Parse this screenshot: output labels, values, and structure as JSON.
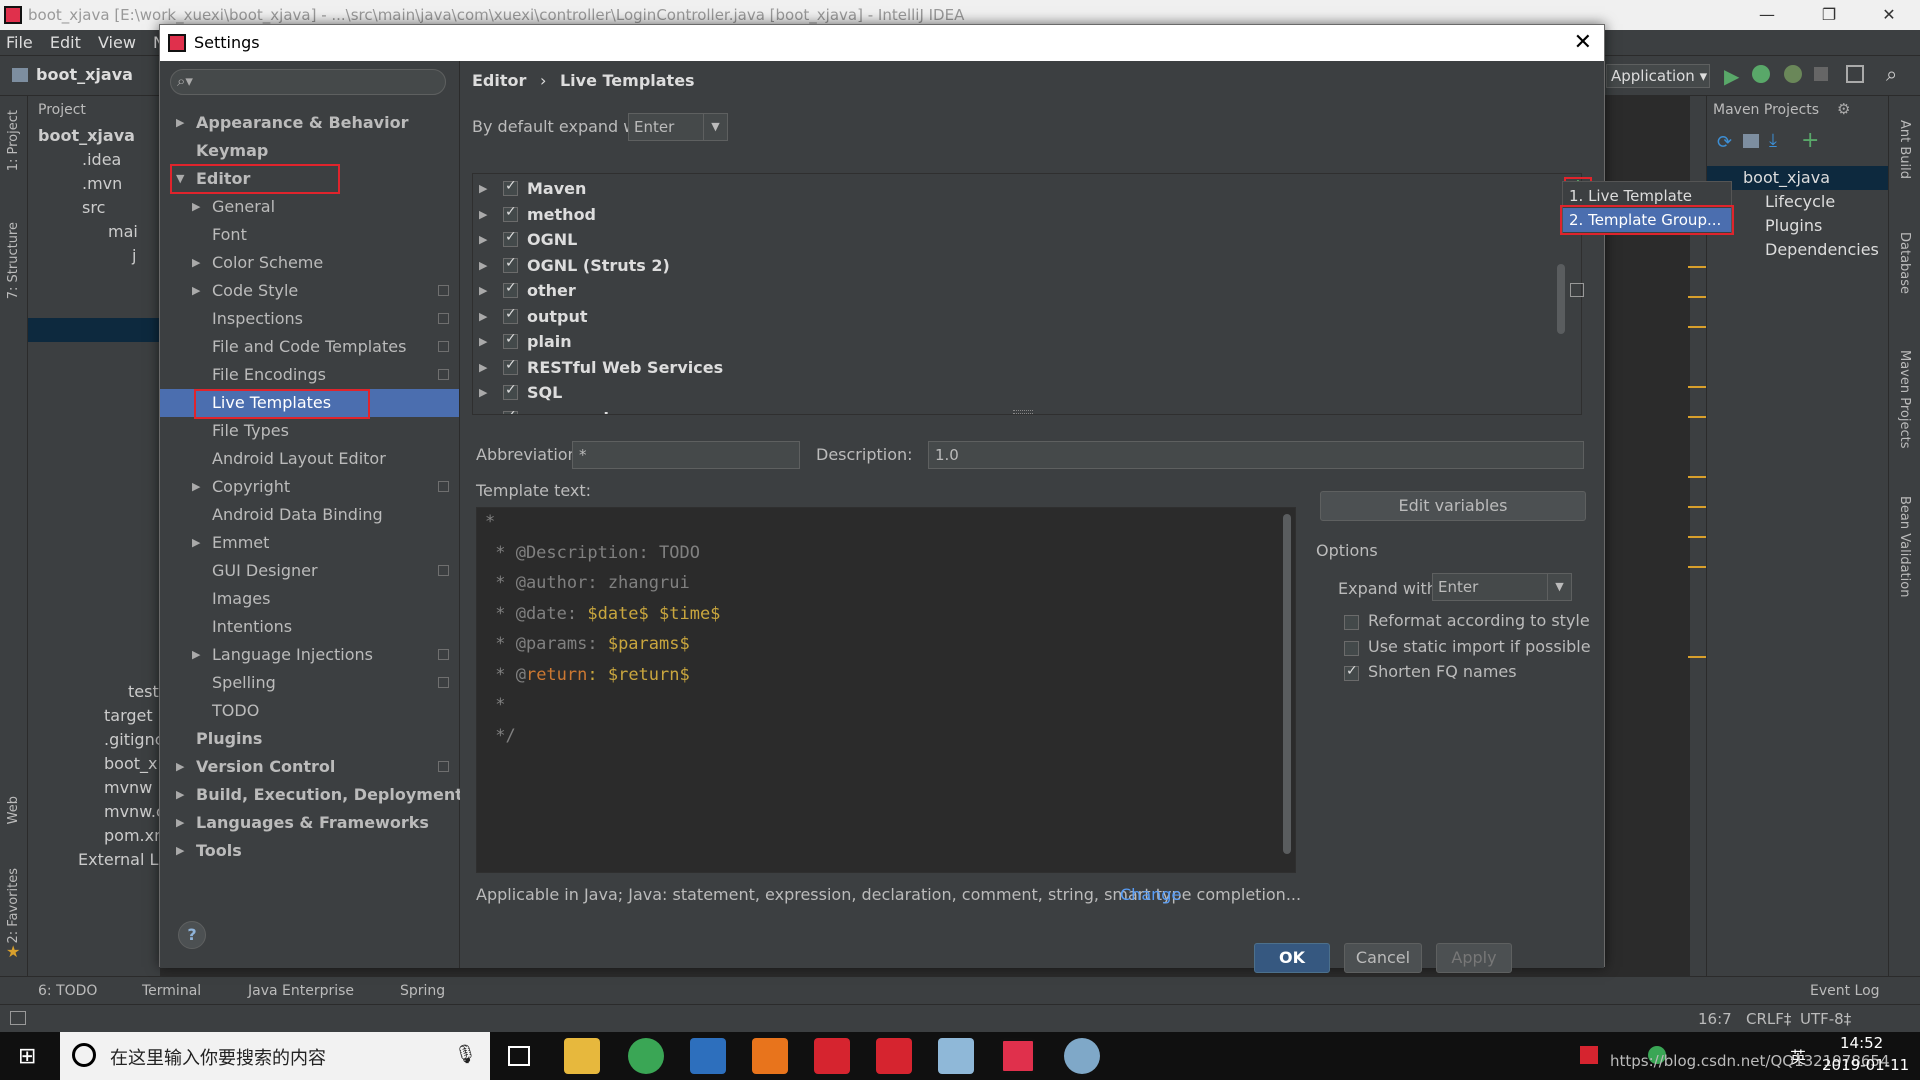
{
  "window": {
    "title": "boot_xjava [E:\\work_xuexi\\boot_xjava] - ...\\src\\main\\java\\com\\xuexi\\controller\\LoginController.java [boot_xjava] - IntelliJ IDEA"
  },
  "menu": [
    "File",
    "Edit",
    "View",
    "Na"
  ],
  "navbar": {
    "project": "boot_xjava",
    "run_config": "Application"
  },
  "project_panel": {
    "header": "Project",
    "rows": [
      "boot_xjava",
      ".idea",
      ".mvn",
      "src",
      "mai",
      "j",
      "",
      "test",
      "target",
      ".gitignc",
      "boot_x",
      "mvnw",
      "mvnw.c",
      "pom.xn",
      "External Lib"
    ]
  },
  "left_strip": {
    "project": "1: Project",
    "structure": "7: Structure",
    "web": "Web",
    "favorites": "2: Favorites"
  },
  "maven": {
    "header": "Maven Projects",
    "root": "boot_xjava",
    "children": [
      "Lifecycle",
      "Plugins",
      "Dependencies"
    ]
  },
  "right_strip": {
    "ant": "Ant Build",
    "database": "Database",
    "maven": "Maven Projects",
    "bean": "Bean Validation"
  },
  "dialog": {
    "title": "Settings",
    "nav": [
      {
        "label": "Appearance & Behavior",
        "bold": true,
        "arrow": true,
        "level": 0
      },
      {
        "label": "Keymap",
        "bold": true,
        "arrow": false,
        "level": 0
      },
      {
        "label": "Editor",
        "bold": true,
        "arrow": "open",
        "level": 0
      },
      {
        "label": "General",
        "arrow": true,
        "level": 1
      },
      {
        "label": "Font",
        "level": 1
      },
      {
        "label": "Color Scheme",
        "arrow": true,
        "level": 1
      },
      {
        "label": "Code Style",
        "arrow": true,
        "level": 1,
        "icon": true
      },
      {
        "label": "Inspections",
        "level": 1,
        "icon": true
      },
      {
        "label": "File and Code Templates",
        "level": 1,
        "icon": true
      },
      {
        "label": "File Encodings",
        "level": 1,
        "icon": true
      },
      {
        "label": "Live Templates",
        "level": 1,
        "selected": true
      },
      {
        "label": "File Types",
        "level": 1
      },
      {
        "label": "Android Layout Editor",
        "level": 1
      },
      {
        "label": "Copyright",
        "arrow": true,
        "level": 1,
        "icon": true
      },
      {
        "label": "Android Data Binding",
        "level": 1
      },
      {
        "label": "Emmet",
        "arrow": true,
        "level": 1
      },
      {
        "label": "GUI Designer",
        "level": 1,
        "icon": true
      },
      {
        "label": "Images",
        "level": 1
      },
      {
        "label": "Intentions",
        "level": 1
      },
      {
        "label": "Language Injections",
        "arrow": true,
        "level": 1,
        "icon": true
      },
      {
        "label": "Spelling",
        "level": 1,
        "icon": true
      },
      {
        "label": "TODO",
        "level": 1
      },
      {
        "label": "Plugins",
        "bold": true,
        "level": 0
      },
      {
        "label": "Version Control",
        "bold": true,
        "arrow": true,
        "level": 0,
        "icon": true
      },
      {
        "label": "Build, Execution, Deployment",
        "bold": true,
        "arrow": true,
        "level": 0
      },
      {
        "label": "Languages & Frameworks",
        "bold": true,
        "arrow": true,
        "level": 0
      },
      {
        "label": "Tools",
        "bold": true,
        "arrow": true,
        "level": 0
      }
    ],
    "breadcrumb": {
      "a": "Editor",
      "sep": "›",
      "b": "Live Templates"
    },
    "expand_label": "By default expand with",
    "expand_value": "Enter",
    "groups": [
      "Maven",
      "method",
      "OGNL",
      "OGNL (Struts 2)",
      "other",
      "output",
      "plain",
      "RESTful Web Services",
      "SQL",
      "surround"
    ],
    "add_menu": [
      "1. Live Template",
      "2. Template Group..."
    ],
    "abbreviation_label": "Abbreviation:",
    "abbreviation_value": "*",
    "description_label": "Description:",
    "description_value": "1.0",
    "template_text_label": "Template text:",
    "template_lines": [
      {
        "pre": "*",
        "kw": "",
        "post": ""
      },
      {
        "pre": " * @Description: TODO",
        "kw": "",
        "post": ""
      },
      {
        "pre": " * @author: zhangrui",
        "kw": "",
        "post": ""
      },
      {
        "pre": " * @date: ",
        "kw": "",
        "post": "$date$ $time$"
      },
      {
        "pre": " * @params: ",
        "kw": "",
        "post": "$params$"
      },
      {
        "pre": " * @",
        "kw": "return",
        "post": ": $return$"
      },
      {
        "pre": " *",
        "kw": "",
        "post": ""
      },
      {
        "pre": " */",
        "kw": "",
        "post": ""
      }
    ],
    "edit_variables": "Edit variables",
    "options_label": "Options",
    "expand_with_label": "Expand with",
    "expand_with_value": "Enter",
    "options": [
      {
        "label": "Reformat according to style",
        "checked": false
      },
      {
        "label": "Use static import if possible",
        "checked": false
      },
      {
        "label": "Shorten FQ names",
        "checked": true
      }
    ],
    "applicable": "Applicable in Java; Java: statement, expression, declaration, comment, string, smart type completion...",
    "change_link": "Change",
    "ok": "OK",
    "cancel": "Cancel",
    "apply": "Apply",
    "help": "?"
  },
  "bottom_tools": [
    "6: TODO",
    "Terminal",
    "Java Enterprise",
    "Spring"
  ],
  "event_log": "Event Log",
  "status": {
    "position": "16:7",
    "line_sep": "CRLF‡",
    "encoding": "UTF-8‡"
  },
  "taskbar": {
    "search_placeholder": "在这里输入你要搜索的内容",
    "time": "14:52",
    "date": "2019-01-11",
    "watermark": "https://blog.csdn.net/QQ1321978654",
    "ime": "英"
  }
}
